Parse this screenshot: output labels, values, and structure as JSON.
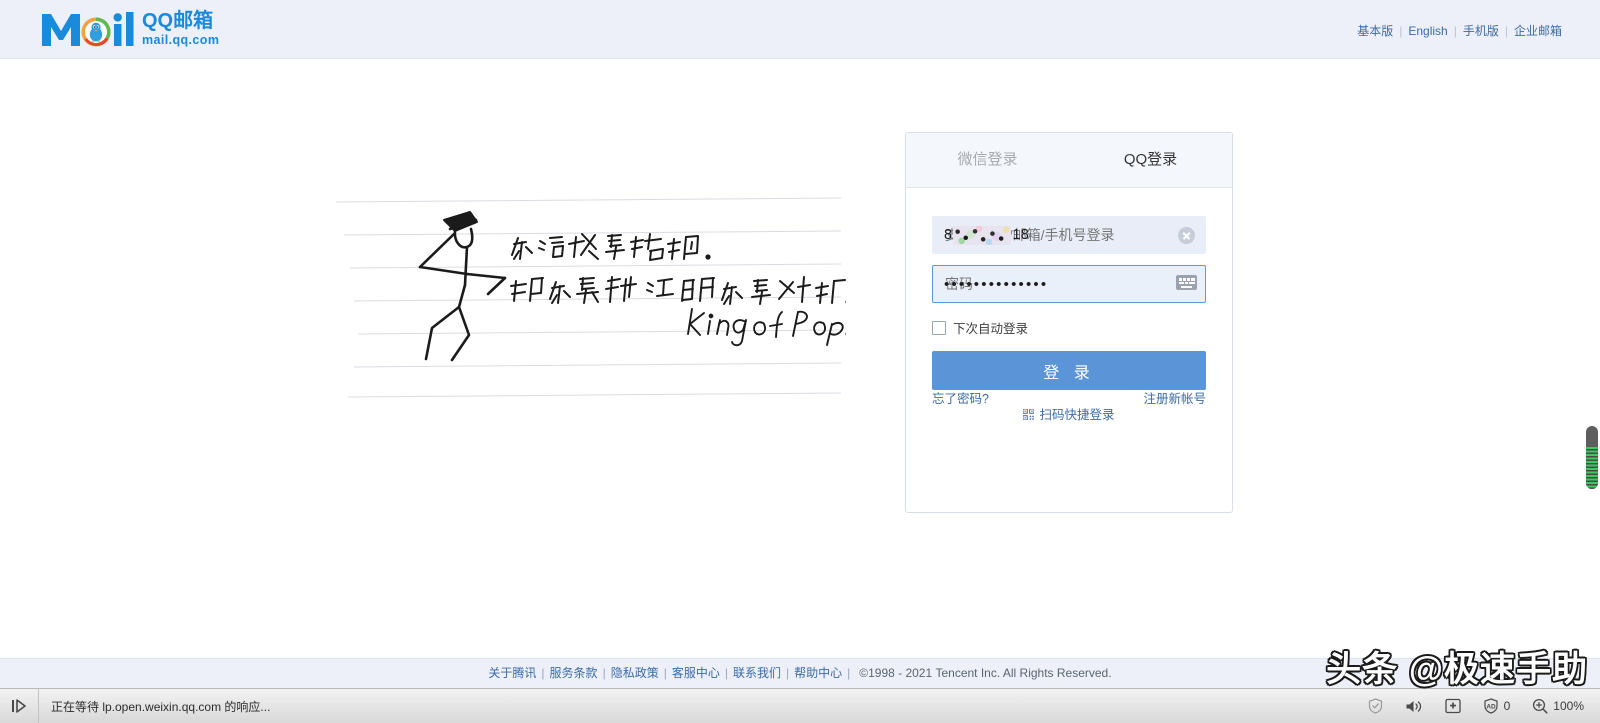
{
  "header": {
    "logo": {
      "wordmark": "Mail",
      "title": "QQ邮箱",
      "domain": "mail.qq.com"
    },
    "nav": [
      {
        "label": "基本版"
      },
      {
        "label": "English"
      },
      {
        "label": "手机版"
      },
      {
        "label": "企业邮箱"
      }
    ],
    "separator": "|",
    "background_color": "#edf0f9"
  },
  "illustration": {
    "line1": "你说我是错的.",
    "line2": "那你最好证明你是对的.",
    "signature": "King of Pop.",
    "figure": "michael-jackson-stick-figure",
    "paper": "ruled-notebook-lines"
  },
  "login": {
    "tabs": [
      {
        "label": "微信登录",
        "active": false
      },
      {
        "label": "QQ登录",
        "active": true
      }
    ],
    "username": {
      "value_prefix": "8",
      "value_suffix": "18",
      "placeholder": "支持QQ号/邮箱/手机号登录",
      "censored": true
    },
    "password": {
      "dots": "••••••••••••••",
      "placeholder": "密码",
      "focused": true
    },
    "auto_login_label": "下次自动登录",
    "auto_login_checked": false,
    "submit_label": "登 录",
    "qr_login_label": "扫码快捷登录",
    "forgot_password_label": "忘了密码?",
    "register_label": "注册新帐号",
    "accent_color": "#5b95d8",
    "link_color": "#3b6ba5"
  },
  "footer": {
    "links": [
      {
        "label": "关于腾讯"
      },
      {
        "label": "服务条款"
      },
      {
        "label": "隐私政策"
      },
      {
        "label": "客服中心"
      },
      {
        "label": "联系我们"
      },
      {
        "label": "帮助中心"
      }
    ],
    "separator": "|",
    "copyright": "©1998 - 2021 Tencent Inc. All Rights Reserved."
  },
  "watermark": {
    "text": "头条 @极速手助"
  },
  "browser_status_bar": {
    "status_text": "正在等待 lp.open.weixin.qq.com 的响应...",
    "ad_block_count": "0",
    "zoom_level": "100%",
    "icons": {
      "media_control": "play-pause-icon",
      "shield": "shield-check-icon",
      "sound": "speaker-icon",
      "save": "download-box-icon",
      "adblock": "ad-block-icon",
      "zoom": "zoom-in-icon"
    }
  },
  "scrollbar": {
    "orientation": "vertical",
    "position_percent": 42
  }
}
